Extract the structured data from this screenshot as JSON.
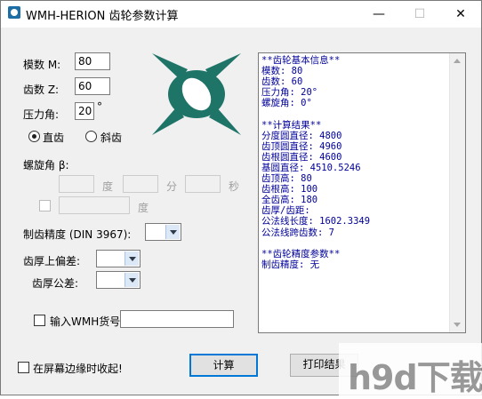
{
  "window": {
    "title": "WMH-HERION 齿轮参数计算",
    "minimize": "—",
    "maximize": "☐",
    "close": "✕"
  },
  "form": {
    "module_label": "模数 M:",
    "module_value": "80",
    "teeth_label": "齿数 Z:",
    "teeth_value": "60",
    "pressure_label": "压力角:",
    "pressure_value": "20",
    "pressure_unit": "°",
    "spur_label": "直齿",
    "helical_label": "斜齿",
    "gear_type_selected": "直齿",
    "helix_label": "螺旋角 β:",
    "unit_degree": "度",
    "unit_minute": "分",
    "unit_second": "秒",
    "precision_label": "制齿精度 (DIN 3967):",
    "upper_dev_label": "齿厚上偏差:",
    "tolerance_label": "齿厚公差:",
    "wmh_label": "输入WMH货号",
    "collapse_label": "在屏幕边缘时收起!"
  },
  "buttons": {
    "calc": "计算",
    "print": "打印结果"
  },
  "result": {
    "text": "**齿轮基本信息**\n模数: 80\n齿数: 60\n压力角: 20°\n螺旋角: 0°\n\n**计算结果**\n分度圆直径: 4800\n齿顶圆直径: 4960\n齿根圆直径: 4600\n基圆直径: 4510.5246\n齿顶高: 80\n齿根高: 100\n全齿高: 180\n齿厚/齿距: \n公法线长度: 1602.3349\n公法线跨齿数: 7\n\n**齿轮精度参数**\n制齿精度: 无"
  },
  "watermark": "h9d下载",
  "colors": {
    "logo": "#1f7468",
    "result_text": "#000099",
    "focus_border": "#0078d7"
  }
}
